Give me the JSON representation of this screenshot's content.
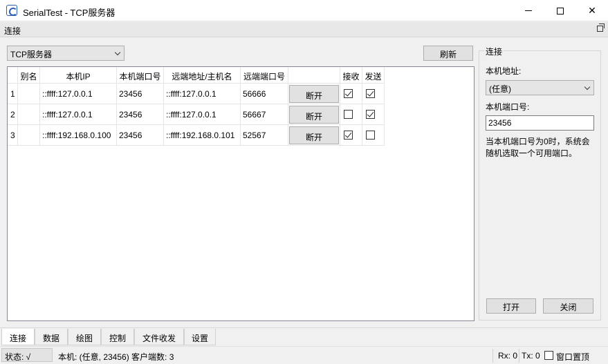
{
  "window": {
    "title": "SerialTest - TCP服务器"
  },
  "dock": {
    "title": "连接"
  },
  "mode": {
    "selected": "TCP服务器"
  },
  "refresh_label": "刷新",
  "table": {
    "headers": [
      "别名",
      "本机IP",
      "本机端口号",
      "远端地址/主机名",
      "远端端口号",
      "",
      "接收",
      "发送"
    ],
    "rows": [
      {
        "index": "1",
        "alias": "",
        "local_ip": "::ffff:127.0.0.1",
        "local_port": "23456",
        "remote_addr": "::ffff:127.0.0.1",
        "remote_port": "56666",
        "action": "断开",
        "recv": true,
        "send": true
      },
      {
        "index": "2",
        "alias": "",
        "local_ip": "::ffff:127.0.0.1",
        "local_port": "23456",
        "remote_addr": "::ffff:127.0.0.1",
        "remote_port": "56667",
        "action": "断开",
        "recv": false,
        "send": true
      },
      {
        "index": "3",
        "alias": "",
        "local_ip": "::ffff:192.168.0.100",
        "local_port": "23456",
        "remote_addr": "::ffff:192.168.0.101",
        "remote_port": "52567",
        "action": "断开",
        "recv": true,
        "send": false
      }
    ]
  },
  "panel": {
    "group_title": "连接",
    "local_addr_label": "本机地址:",
    "local_addr_value": "(任意)",
    "local_port_label": "本机端口号:",
    "local_port_value": "23456",
    "hint": "当本机端口号为0时，系统会随机选取一个可用端口。",
    "open_label": "打开",
    "close_label": "关闭"
  },
  "tabs": [
    "连接",
    "数据",
    "绘图",
    "控制",
    "文件收发",
    "设置"
  ],
  "status": {
    "state": "状态: √",
    "info": "本机: (任意, 23456) 客户端数: 3",
    "rx": "Rx: 0",
    "tx": "Tx: 0",
    "ontop_label": "窗口置顶",
    "ontop_checked": false
  }
}
